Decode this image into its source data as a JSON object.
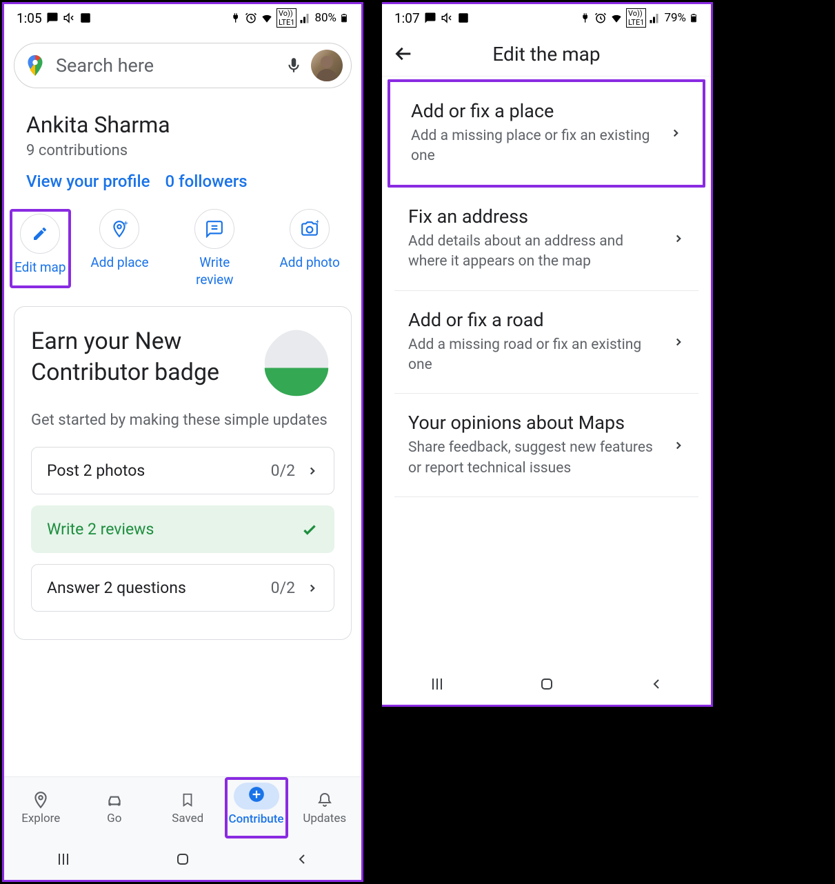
{
  "left": {
    "status": {
      "time": "1:05",
      "battery": "80%"
    },
    "search": {
      "placeholder": "Search here"
    },
    "profile": {
      "name": "Ankita Sharma",
      "contributions": "9 contributions",
      "view_profile": "View your profile",
      "followers": "0 followers"
    },
    "actions": {
      "edit_map": "Edit map",
      "add_place": "Add place",
      "write_review": "Write\nreview",
      "add_photo": "Add photo"
    },
    "card": {
      "title": "Earn your New Contributor badge",
      "sub": "Get started by making these simple updates",
      "tasks": [
        {
          "label": "Post 2 photos",
          "progress": "0/2"
        },
        {
          "label": "Write 2 reviews"
        },
        {
          "label": "Answer 2 questions",
          "progress": "0/2"
        }
      ]
    },
    "nav": {
      "explore": "Explore",
      "go": "Go",
      "saved": "Saved",
      "contribute": "Contribute",
      "updates": "Updates"
    }
  },
  "right": {
    "status": {
      "time": "1:07",
      "battery": "79%"
    },
    "header": "Edit the map",
    "items": [
      {
        "title": "Add or fix a place",
        "sub": "Add a missing place or fix an existing one"
      },
      {
        "title": "Fix an address",
        "sub": "Add details about an address and where it appears on the map"
      },
      {
        "title": "Add or fix a road",
        "sub": "Add a missing road or fix an existing one"
      },
      {
        "title": "Your opinions about Maps",
        "sub": "Share feedback, suggest new features or report technical issues"
      }
    ]
  }
}
